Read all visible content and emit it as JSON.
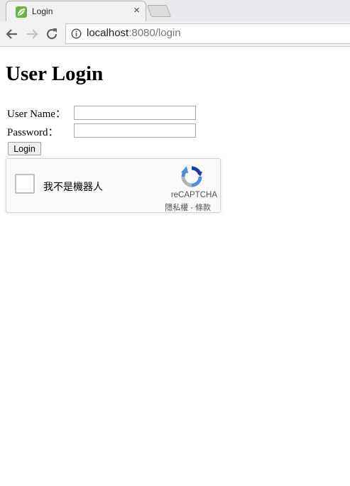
{
  "browser": {
    "tab_title": "Login",
    "close_glyph": "×",
    "url_host": "localhost",
    "url_rest": ":8080/login"
  },
  "page": {
    "heading": "User Login",
    "username_label": "User Name：",
    "password_label": "Password：",
    "username_value": "",
    "password_value": "",
    "login_button": "Login"
  },
  "recaptcha": {
    "checkbox_label": "我不是機器人",
    "brand": "reCAPTCHA",
    "privacy": "隱私權",
    "separator": " - ",
    "terms": "條款"
  },
  "icons": {
    "favicon": "leaf-icon",
    "back": "back-arrow-icon",
    "forward": "forward-arrow-icon",
    "reload": "reload-icon",
    "info": "info-icon",
    "recaptcha_logo": "recaptcha-logo-icon"
  },
  "colors": {
    "favicon_green": "#6db33f",
    "recaptcha_blue": "#4a90e2",
    "recaptcha_dark_blue": "#1c3aa9",
    "recaptcha_gray": "#b3b3b3"
  }
}
